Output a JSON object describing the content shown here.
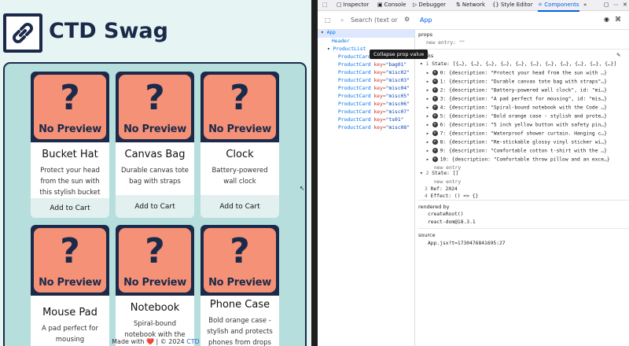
{
  "site": {
    "title": "CTD Swag",
    "footer_prefix": "Made with ❤️ | © 2024",
    "footer_link": "CTD"
  },
  "placeholder": {
    "question": "?",
    "no_preview": "No Preview"
  },
  "products": [
    {
      "name": "Bucket Hat",
      "desc": "Protect your head from the sun with this stylish bucket hat",
      "button": "Add to Cart"
    },
    {
      "name": "Canvas Bag",
      "desc": "Durable canvas tote bag with straps",
      "button": "Add to Cart"
    },
    {
      "name": "Clock",
      "desc": "Battery-powered wall clock",
      "button": "Add to Cart"
    },
    {
      "name": "Mouse Pad",
      "desc": "A pad perfect for mousing",
      "button": ""
    },
    {
      "name": "Notebook",
      "desc": "Spiral-bound notebook with the",
      "button": ""
    },
    {
      "name": "Phone Case",
      "desc": "Bold orange case - stylish and protects phones from drops up",
      "button": ""
    }
  ],
  "devtools": {
    "tabs": [
      "Inspector",
      "Console",
      "Debugger",
      "Network",
      "Style Editor",
      "Components"
    ],
    "active_tab": "Components",
    "search_placeholder": "Search (text or",
    "breadcrumb": "App",
    "tree": {
      "app": "App",
      "header": "Header",
      "productlist": "ProductList",
      "card": "ProductCard",
      "key_attr": "key="
    },
    "tree_keys": [
      "\"bag01\"",
      "\"misc02\"",
      "\"misc03\"",
      "\"misc04\"",
      "\"misc05\"",
      "\"misc06\"",
      "\"misc07\"",
      "\"ts01\"",
      "\"misc08\""
    ],
    "tooltip": "Collapse prop value",
    "props_label": "props",
    "props_entry": "new entry: \"\"",
    "hooks_label": "hooks",
    "state_summary": "State: [{…}, {…}, {…}, {…}, {…}, {…}, {…}, {…}, {…}, {…}, {…}]",
    "state_items": [
      "0: {description: \"Protect your head from the sun with …}",
      "1: {description: \"Durable canvas tote bag with straps\"…}",
      "2: {description: \"Battery-powered wall clock\", id: \"mi…}",
      "3: {description: \"A pad perfect for mousing\", id: \"mis…}",
      "4: {description: \"Spiral-bound notebook with the Code …}",
      "5: {description: \"Bold orange case - stylish and prote…}",
      "6: {description: \"5 inch yellow button with safety pin…}",
      "7: {description: \"Waterproof shower curtain. Hanging c…}",
      "8: {description: \"Re-stickable glossy vinyl sticker wi…}",
      "9: {description: \"Comfortable cotton t-shirt with the …}",
      "10: {description: \"Comfortable throw pillow and an exce…}"
    ],
    "new_entry": "new entry",
    "state2": "State: []",
    "state_num_1": "1",
    "state_num_2": "2",
    "ref_num": "3",
    "effect_num": "4",
    "ref": "Ref: 2024",
    "effect": "Effect: () => {}",
    "rendered_by_label": "rendered by",
    "rendered_by": [
      "createRoot()",
      "react-dom@18.3.1"
    ],
    "source_label": "source",
    "source": "App.jsx?t=1730476841695:27",
    "colors": {
      "active": "#0061e0",
      "navy": "#1c2a4a",
      "coral": "#f49177",
      "teal": "#b6dedd"
    }
  }
}
